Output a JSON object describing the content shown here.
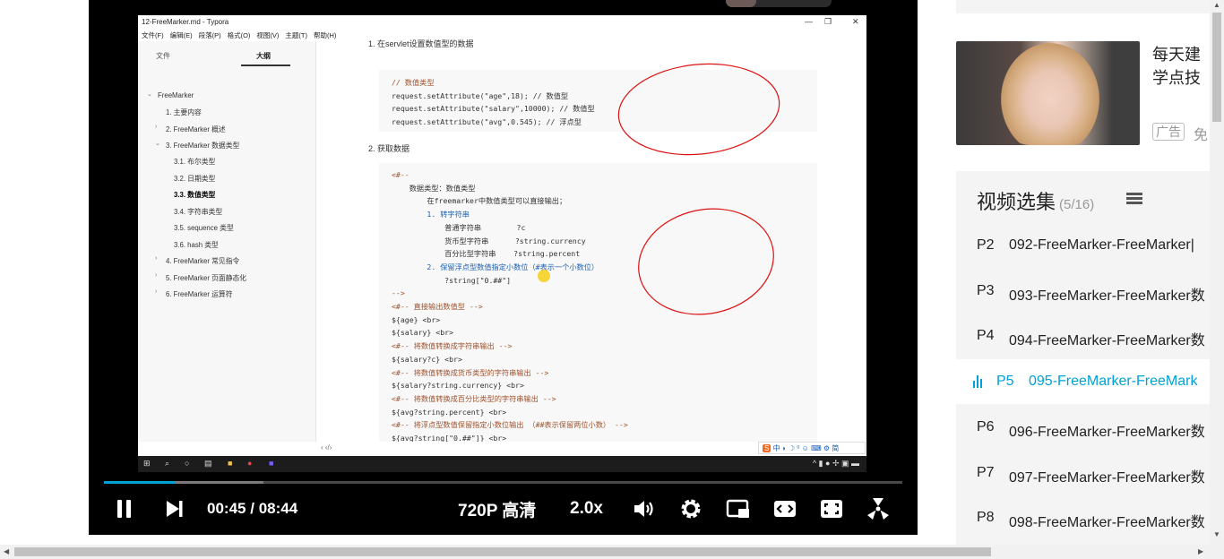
{
  "typora": {
    "title": "12-FreeMarker.md - Typora",
    "win_min": "—",
    "win_max": "❐",
    "win_close": "✕",
    "menu": [
      "文件(F)",
      "编辑(E)",
      "段落(P)",
      "格式(O)",
      "视图(V)",
      "主题(T)",
      "帮助(H)"
    ],
    "tab_files": "文件",
    "tab_outline": "大纲",
    "outline": [
      {
        "text": "FreeMarker",
        "arrow": "⌄"
      },
      {
        "text": "1. 主要内容",
        "arrow": ""
      },
      {
        "text": "2. FreeMarker 概述",
        "arrow": "›"
      },
      {
        "text": "3. FreeMarker 数据类型",
        "arrow": "⌄"
      },
      {
        "text": "3.1. 布尔类型",
        "arrow": ""
      },
      {
        "text": "3.2. 日期类型",
        "arrow": ""
      },
      {
        "text": "3.3. 数值类型",
        "arrow": ""
      },
      {
        "text": "3.4. 字符串类型",
        "arrow": ""
      },
      {
        "text": "3.5. sequence 类型",
        "arrow": ""
      },
      {
        "text": "3.6. hash 类型",
        "arrow": ""
      },
      {
        "text": "4. FreeMarker 常见指令",
        "arrow": "›"
      },
      {
        "text": "5. FreeMarker 页面静态化",
        "arrow": "›"
      },
      {
        "text": "6. FreeMarker 运算符",
        "arrow": "›"
      }
    ],
    "cut_heading": "1. 在servlet设置数值型的数据",
    "heading2": "2. 获取数据",
    "code1": [
      "// 数值类型",
      "request.setAttribute(\"age\",18); // 数值型",
      "request.setAttribute(\"salary\",10000); // 数值型",
      "request.setAttribute(\"avg\",0.545); // 浮点型"
    ],
    "code2": [
      "<#--",
      "    数据类型：数值类型",
      "        在freemarker中数值类型可以直接输出；",
      "        1. 转字符串",
      "            普通字符串        ?c",
      "            货币型字符串      ?string.currency",
      "            百分比型字符串    ?string.percent",
      "        2. 保留浮点型数值指定小数位（#表示一个小数位）",
      "            ?string[\"0.##\"]",
      "-->",
      "<#-- 直接输出数值型 -->",
      "${age} <br>",
      "${salary} <br>",
      "<#-- 将数值转换成字符串输出 -->",
      "${salary?c} <br>",
      "<#-- 将数值转换成货币类型的字符串输出 -->",
      "${salary?string.currency} <br>",
      "<#-- 将数值转换成百分比类型的字符串输出 -->",
      "${avg?string.percent} <br>",
      "<#-- 将浮点型数值保留指定小数位输出 （##表示保留两位小数） -->",
      "${avg?string[\"0.##\"]} <br>"
    ],
    "footer_left": "‹  ‹/›",
    "ime_logo": "S",
    "ime_text": "中 ◗ ☽ ⁰ ☺ ⌨ ⚙ 简"
  },
  "player": {
    "current_time": "00:45",
    "time_sep": "/",
    "duration": "08:44",
    "progress": 0.089,
    "buffered": 0.2,
    "quality": "720P 高清",
    "speed": "2.0x",
    "accent": "#00a1d6"
  },
  "ad": {
    "title_line1": "每天建",
    "title_line2": "学点技",
    "tag": "广告",
    "tag2": "免"
  },
  "playlist": {
    "title": "视频选集",
    "count": "(5/16)",
    "items": [
      {
        "ep": "P2",
        "name": "092-FreeMarker-FreeMarker|",
        "active": false
      },
      {
        "ep": "P3",
        "name": "093-FreeMarker-FreeMarker数",
        "active": false
      },
      {
        "ep": "P4",
        "name": "094-FreeMarker-FreeMarker数",
        "active": false
      },
      {
        "ep": "P5",
        "name": "095-FreeMarker-FreeMark",
        "active": true
      },
      {
        "ep": "P6",
        "name": "096-FreeMarker-FreeMarker数",
        "active": false
      },
      {
        "ep": "P7",
        "name": "097-FreeMarker-FreeMarker数",
        "active": false
      },
      {
        "ep": "P8",
        "name": "098-FreeMarker-FreeMarker数",
        "active": false
      }
    ]
  }
}
